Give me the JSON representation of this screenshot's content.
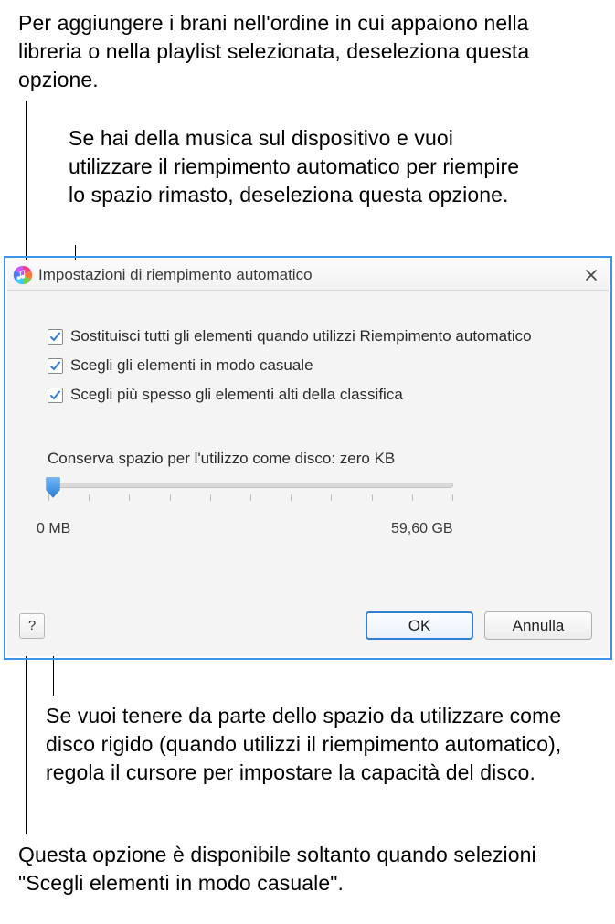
{
  "callouts": {
    "top1": "Per aggiungere i brani nell'ordine in cui appaiono nella libreria o nella playlist selezionata, deseleziona questa opzione.",
    "top2": "Se hai della musica sul dispositivo e vuoi utilizzare il riempimento automatico per riempire lo spazio rimasto, deseleziona questa opzione.",
    "bottom1": "Se vuoi tenere da parte dello spazio da utilizzare come disco rigido (quando utilizzi il riempimento automatico), regola il cursore per impostare la capacità del disco.",
    "bottom2": "Questa opzione è disponibile soltanto quando selezioni \"Scegli elementi in modo casuale\"."
  },
  "dialog": {
    "title": "Impostazioni di riempimento automatico",
    "checkboxes": {
      "replace": {
        "label": "Sostituisci tutti gli elementi quando utilizzi Riempimento automatico",
        "checked": true
      },
      "random": {
        "label": "Scegli gli elementi in modo casuale",
        "checked": true
      },
      "higher": {
        "label": "Scegli più spesso gli elementi alti della classifica",
        "checked": true
      }
    },
    "reserve": {
      "label_prefix": "Conserva spazio per l'utilizzo come disco: ",
      "value_text": "zero KB",
      "min_label": "0 MB",
      "max_label": "59,60 GB",
      "slider_value": 0,
      "slider_min": 0,
      "slider_max": 59.6
    },
    "buttons": {
      "help": "?",
      "ok": "OK",
      "cancel": "Annulla"
    }
  },
  "icons": {
    "app": "itunes-icon",
    "close": "close-icon",
    "check": "checkmark-icon",
    "slider": "slider-thumb-icon"
  },
  "colors": {
    "accent": "#2f7fd8",
    "frame": "#3e94e8"
  }
}
